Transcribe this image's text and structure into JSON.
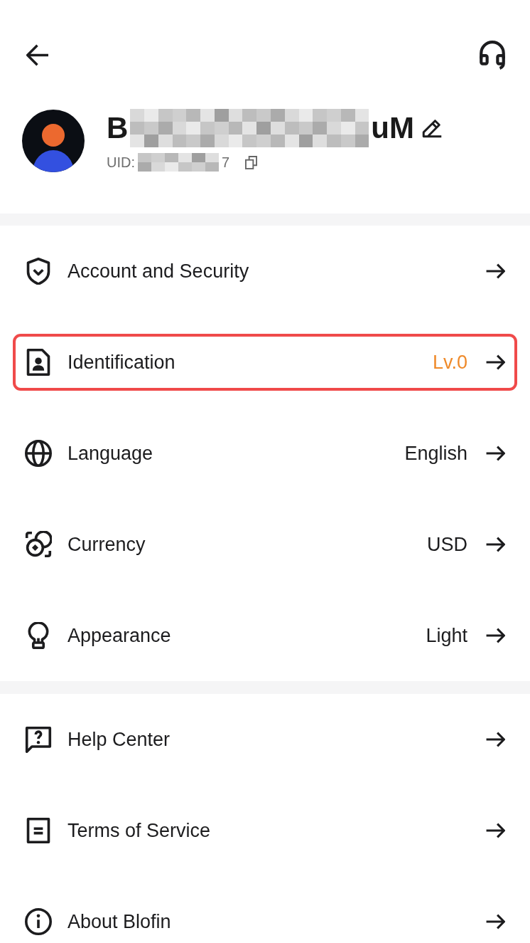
{
  "profile": {
    "name_start": "B",
    "name_end": "uM",
    "uid_label": "UID:",
    "uid_end": "7"
  },
  "sections": [
    {
      "items": [
        {
          "label": "Account and Security",
          "highlighted": false
        },
        {
          "label": "Identification",
          "value": "Lv.0",
          "color": "#ef8a2a",
          "highlighted": true
        },
        {
          "label": "Language",
          "value": "English",
          "highlighted": false
        },
        {
          "label": "Currency",
          "value": "USD",
          "highlighted": false
        },
        {
          "label": "Appearance",
          "value": "Light",
          "highlighted": false
        }
      ]
    },
    {
      "items": [
        {
          "label": "Help Center",
          "highlighted": false
        },
        {
          "label": "Terms of Service",
          "highlighted": false
        },
        {
          "label": "About Blofin",
          "highlighted": false
        }
      ]
    }
  ]
}
